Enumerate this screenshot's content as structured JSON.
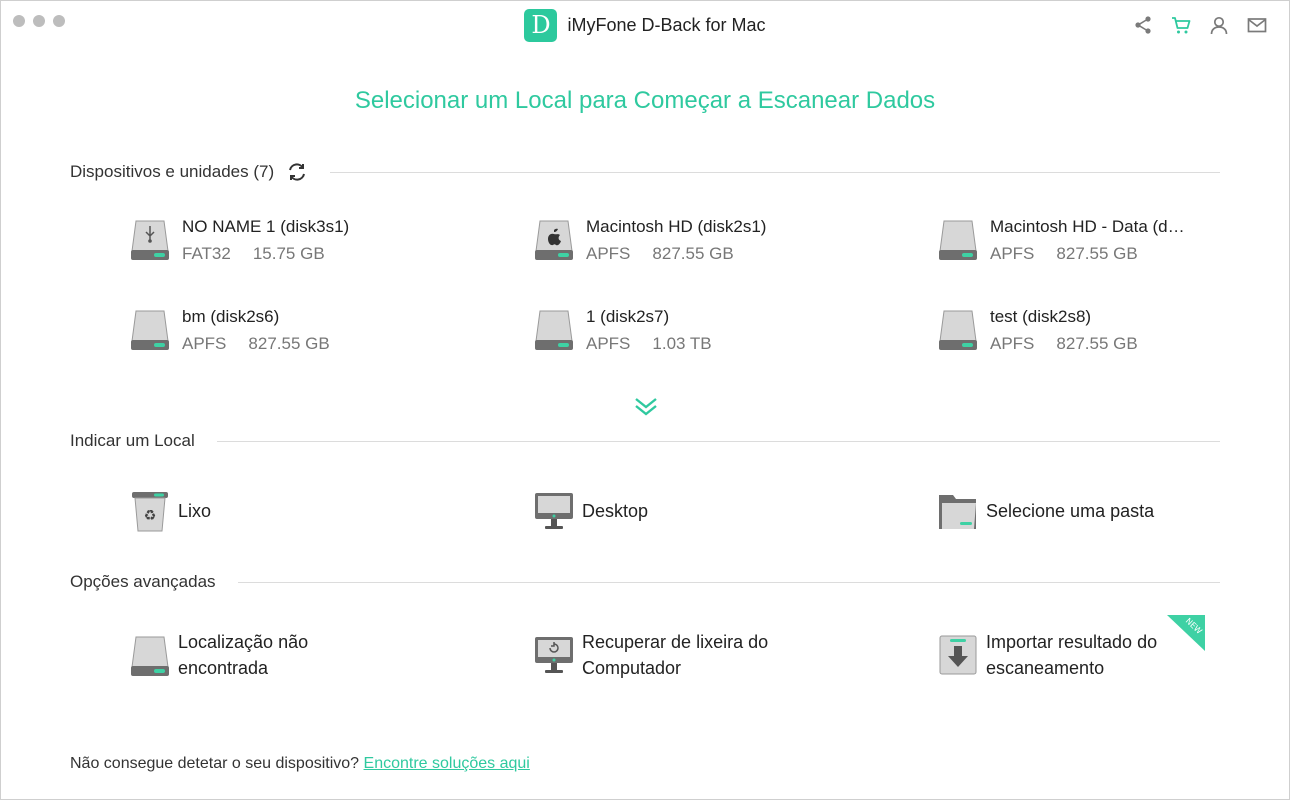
{
  "window": {
    "title": "iMyFone D-Back for Mac",
    "logo_letter": "D"
  },
  "toolbar": {
    "icons": [
      "share-icon",
      "cart-icon",
      "account-icon",
      "mail-icon"
    ],
    "accent_color": "#2fc99f"
  },
  "heading": "Selecionar um Local para Começar a Escanear Dados",
  "devices": {
    "label": "Dispositivos e unidades (7)",
    "items": [
      {
        "name": "NO NAME 1 (disk3s1)",
        "fs": "FAT32",
        "size": "15.75 GB",
        "icon": "usb-drive-icon"
      },
      {
        "name": "Macintosh HD (disk2s1)",
        "fs": "APFS",
        "size": "827.55 GB",
        "icon": "apple-drive-icon"
      },
      {
        "name": "Macintosh HD - Data (d…",
        "fs": "APFS",
        "size": "827.55 GB",
        "icon": "hard-drive-icon"
      },
      {
        "name": "bm (disk2s6)",
        "fs": "APFS",
        "size": "827.55 GB",
        "icon": "hard-drive-icon"
      },
      {
        "name": "1 (disk2s7)",
        "fs": "APFS",
        "size": "1.03 TB",
        "icon": "hard-drive-icon"
      },
      {
        "name": "test (disk2s8)",
        "fs": "APFS",
        "size": "827.55 GB",
        "icon": "hard-drive-icon"
      }
    ]
  },
  "locations": {
    "label": "Indicar um Local",
    "items": [
      {
        "label": "Lixo",
        "icon": "trash-icon"
      },
      {
        "label": "Desktop",
        "icon": "monitor-icon"
      },
      {
        "label": "Selecione uma pasta",
        "icon": "folder-icon"
      }
    ]
  },
  "advanced": {
    "label": "Opções avançadas",
    "items": [
      {
        "line1": "Localização não",
        "line2": "encontrada",
        "icon": "hard-drive-icon"
      },
      {
        "line1": "Recuperar de lixeira do",
        "line2": "Computador",
        "icon": "monitor-restore-icon"
      },
      {
        "line1": "Importar resultado do",
        "line2": "escaneamento",
        "icon": "import-icon",
        "badge": "NEW"
      }
    ]
  },
  "footer": {
    "question": "Não consegue detetar o seu dispositivo?",
    "link": "Encontre soluções aqui"
  }
}
